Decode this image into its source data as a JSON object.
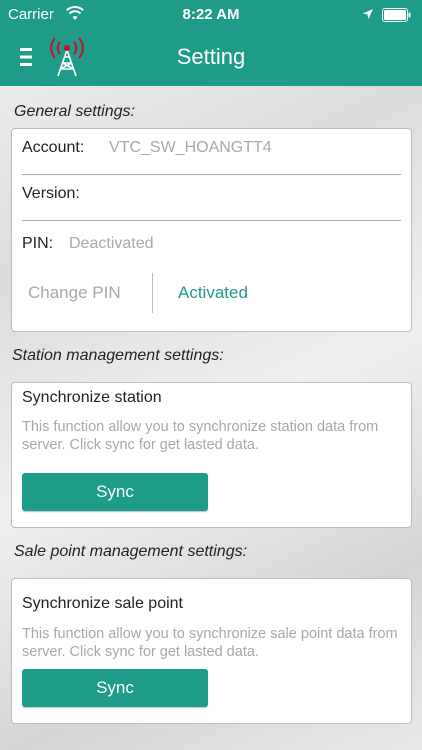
{
  "status_bar": {
    "carrier": "Carrier",
    "time": "8:22 AM",
    "icons": [
      "wifi-icon",
      "location-arrow-icon",
      "battery-icon"
    ]
  },
  "nav": {
    "title": "Setting",
    "icons": [
      "menu-icon",
      "antenna-tower-logo"
    ]
  },
  "general": {
    "title": "General settings:",
    "account_label": "Account:",
    "account_value": "VTC_SW_HOANGTT4",
    "version_label": "Version:",
    "version_value": "",
    "pin_label": "PIN:",
    "pin_value": "Deactivated",
    "change_pin_label": "Change PIN",
    "activated_label": "Activated"
  },
  "station": {
    "title": "Station management settings:",
    "heading": "Synchronize station",
    "description": "This function allow you to synchronize station data from server. Click sync for get lasted data.",
    "button": "Sync"
  },
  "sale_point": {
    "title": "Sale point management settings:",
    "heading": "Synchronize sale point",
    "description": "This function allow you to synchronize sale point data from server. Click sync for get lasted data.",
    "button": "Sync"
  },
  "colors": {
    "primary": "#1f9b8a",
    "logo_red": "#c8102e",
    "muted_text": "#a8a8a8"
  }
}
